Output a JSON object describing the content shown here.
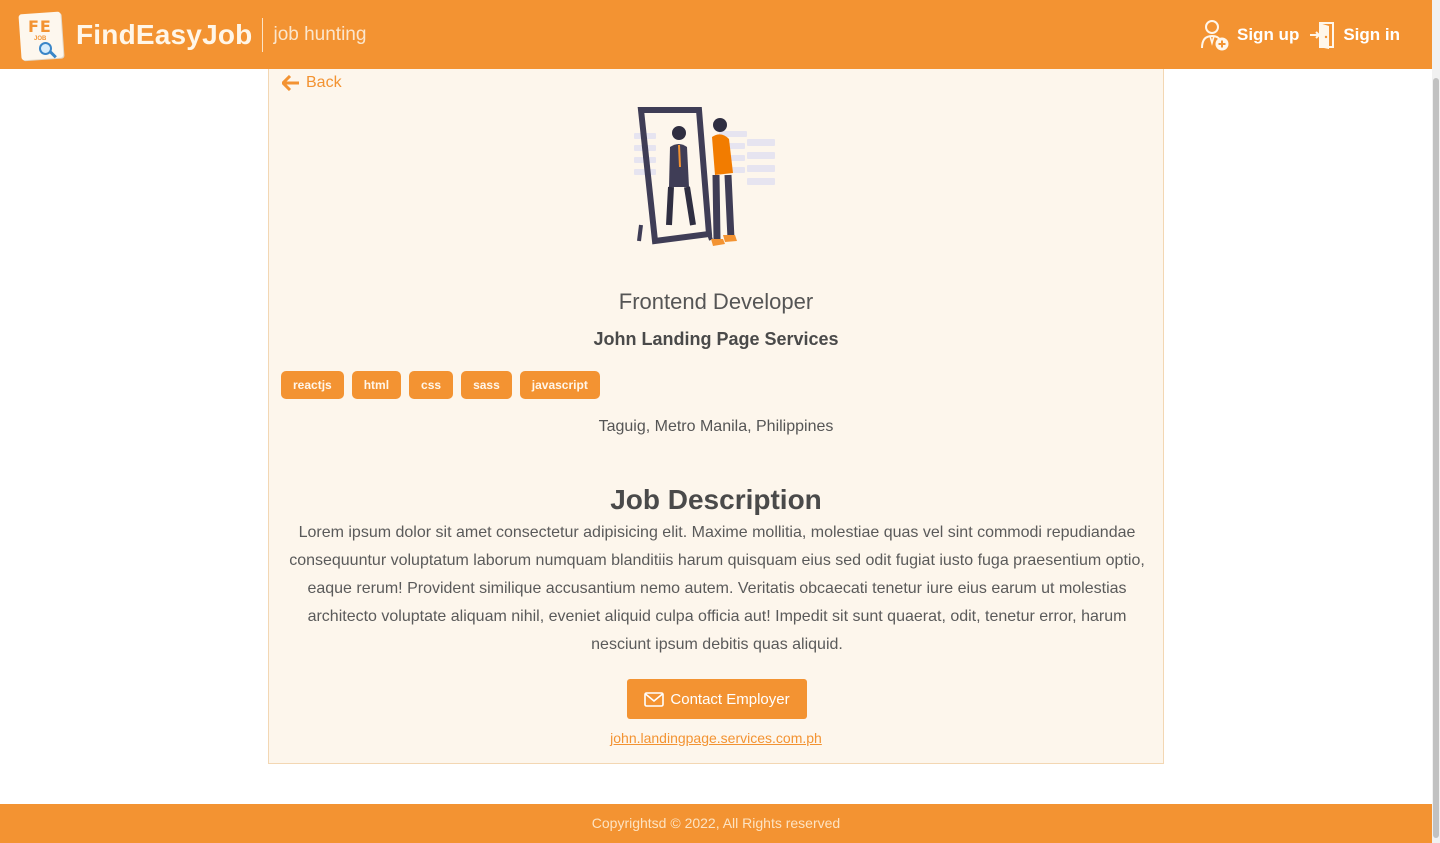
{
  "header": {
    "brand": "FindEasyJob",
    "tagline": "job hunting",
    "logo_text": "FE",
    "logo_sub": "JOB",
    "signup_label": "Sign up",
    "signin_label": "Sign in"
  },
  "job": {
    "back_label": "Back",
    "title": "Frontend Developer",
    "company": "John Landing Page Services",
    "tags": [
      "reactjs",
      "html",
      "css",
      "sass",
      "javascript"
    ],
    "location": "Taguig, Metro Manila, Philippines",
    "description_heading": "Job Description",
    "description": "Lorem ipsum dolor sit amet consectetur adipisicing elit. Maxime mollitia, molestiae quas vel sint commodi repudiandae consequuntur voluptatum laborum numquam blanditiis harum quisquam eius sed odit fugiat iusto fuga praesentium optio, eaque rerum! Provident similique accusantium nemo autem. Veritatis obcaecati tenetur iure eius earum ut molestias architecto voluptate aliquam nihil, eveniet aliquid culpa officia aut! Impedit sit sunt quaerat, odit, tenetur error, harum nesciunt ipsum debitis quas aliquid.",
    "contact_label": "Contact Employer",
    "email": "john.landingpage.services.com.ph"
  },
  "footer": {
    "copyright": "Copyrightsd © 2022, All Rights reserved"
  },
  "colors": {
    "accent": "#f39332",
    "card_bg": "#fdf6ec",
    "text": "#4a4a4a"
  },
  "icons": {
    "back": "arrow-left-icon",
    "signup": "user-add-icon",
    "signin": "sign-in-door-icon",
    "contact": "envelope-icon",
    "logo": "magnifier-icon"
  }
}
